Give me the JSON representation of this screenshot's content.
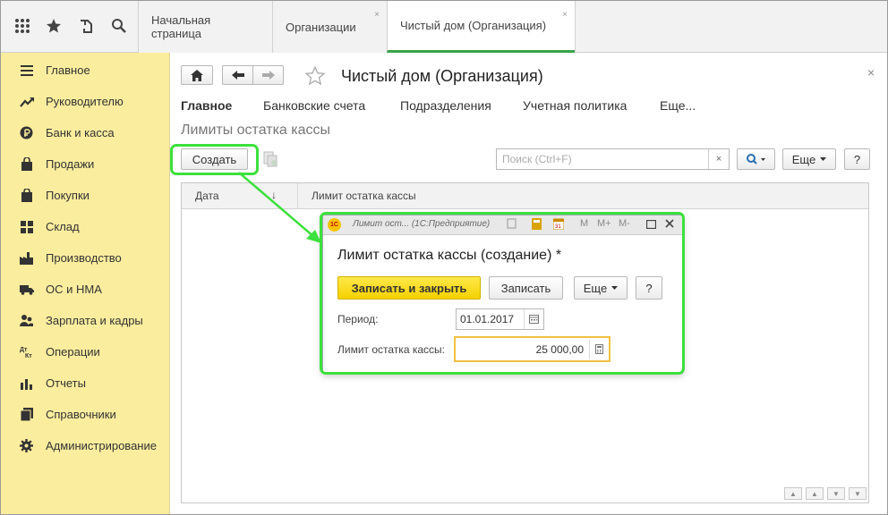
{
  "topbar": {
    "tabs": [
      {
        "label": "Начальная страница"
      },
      {
        "label": "Организации",
        "close": "×"
      },
      {
        "label": "Чистый дом (Организация)",
        "close": "×"
      }
    ]
  },
  "sidebar": {
    "items": [
      {
        "label": "Главное",
        "icon": "menu-lines-icon"
      },
      {
        "label": "Руководителю",
        "icon": "trend-icon"
      },
      {
        "label": "Банк и касса",
        "icon": "ruble-icon"
      },
      {
        "label": "Продажи",
        "icon": "bag-icon"
      },
      {
        "label": "Покупки",
        "icon": "cart-icon"
      },
      {
        "label": "Склад",
        "icon": "grid-icon"
      },
      {
        "label": "Производство",
        "icon": "factory-icon"
      },
      {
        "label": "ОС и НМА",
        "icon": "truck-icon"
      },
      {
        "label": "Зарплата и кадры",
        "icon": "people-icon"
      },
      {
        "label": "Операции",
        "icon": "dt-kt-icon"
      },
      {
        "label": "Отчеты",
        "icon": "bar-chart-icon"
      },
      {
        "label": "Справочники",
        "icon": "books-icon"
      },
      {
        "label": "Администрирование",
        "icon": "gear-icon"
      }
    ]
  },
  "form": {
    "title": "Чистый дом (Организация)",
    "close": "×",
    "tabs": [
      "Главное",
      "Банковские счета",
      "Подразделения",
      "Учетная политика",
      "Еще..."
    ],
    "section_title": "Лимиты остатка кассы",
    "create_label": "Создать",
    "search_placeholder": "Поиск (Ctrl+F)",
    "search_clear": "×",
    "more_label": "Еще",
    "help_label": "?",
    "columns": [
      "Дата",
      "Лимит остатка кассы"
    ],
    "sort_arrow": "↓"
  },
  "dialog": {
    "titlebar": "Лимит ост...  (1С:Предприятие)",
    "app_badge": "1С",
    "title": "Лимит остатка кассы (создание) *",
    "save_close_label": "Записать и закрыть",
    "save_label": "Записать",
    "more_label": "Еще",
    "help_label": "?",
    "period_label": "Период:",
    "period_value": "01.01.2017",
    "limit_label": "Лимит остатка кассы:",
    "limit_value": "25 000,00",
    "titlebar_controls": [
      "M",
      "M+",
      "M-"
    ]
  },
  "colors": {
    "sidebar_bg": "#fbed9e",
    "accent_green": "#3de03d",
    "primary_yellow": "#f5d100"
  }
}
